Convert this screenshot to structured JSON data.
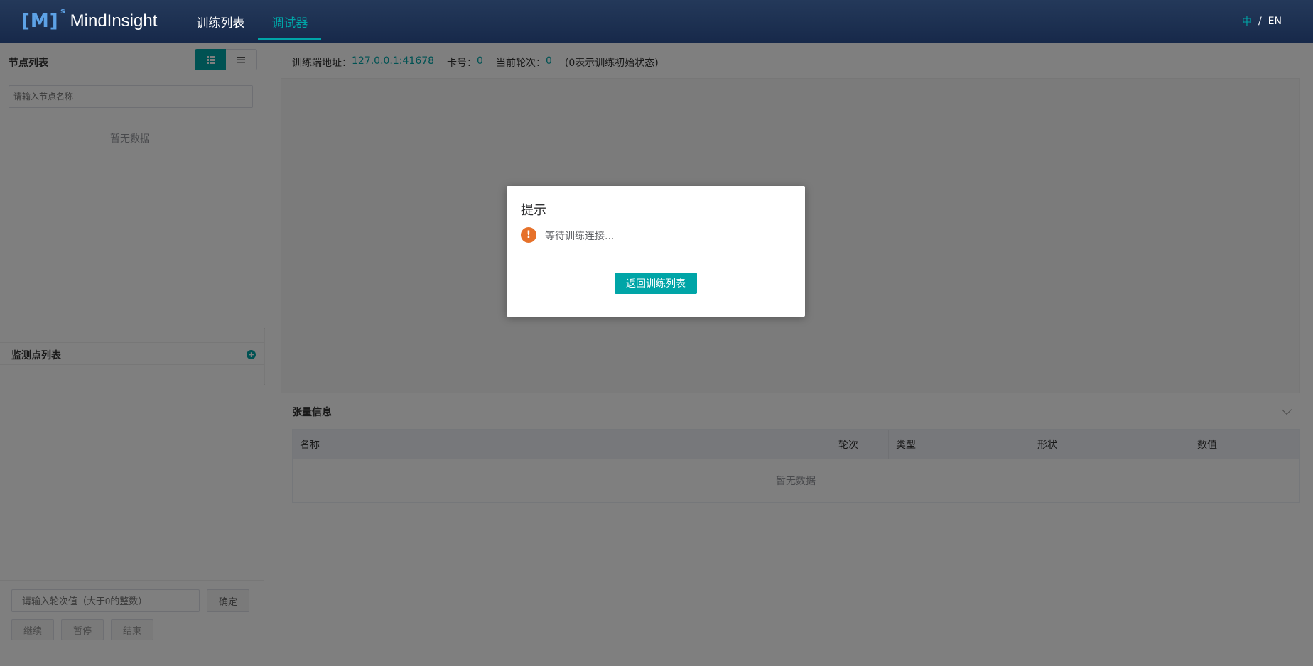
{
  "header": {
    "logo_mark": "[M]",
    "logo_sup": "s",
    "logo_text": "MindInsight",
    "nav": [
      {
        "label": "训练列表",
        "active": false
      },
      {
        "label": "调试器",
        "active": true
      }
    ],
    "lang_zh": "中",
    "lang_sep": "/",
    "lang_en": "EN"
  },
  "left_panel": {
    "node_list_title": "节点列表",
    "view_grid_icon": "grid-icon",
    "view_list_icon": "list-icon",
    "node_search_placeholder": "请输入节点名称",
    "node_empty": "暂无数据",
    "watch_title": "监测点列表",
    "add_icon_glyph": "+",
    "step_placeholder": "请输入轮次值（大于0的整数）",
    "ok_label": "确定",
    "continue_label": "继续",
    "pause_label": "暂停",
    "stop_label": "结束"
  },
  "right_panel": {
    "address_label": "训练端地址：",
    "address_value": "127.0.0.1:41678",
    "card_label": "卡号：",
    "card_value": "0",
    "step_label": "当前轮次：",
    "step_value": "0",
    "step_note": "(0表示训练初始状态)",
    "tensor_title": "张量信息",
    "table": {
      "columns": [
        "名称",
        "轮次",
        "类型",
        "形状",
        "数值"
      ],
      "empty": "暂无数据"
    }
  },
  "dialog": {
    "title": "提示",
    "icon_glyph": "!",
    "message": "等待训练连接...",
    "button_label": "返回训练列表"
  },
  "colors": {
    "accent": "#00a5a7",
    "header_bg": "#1b2e4f",
    "warn": "#e6712a"
  }
}
